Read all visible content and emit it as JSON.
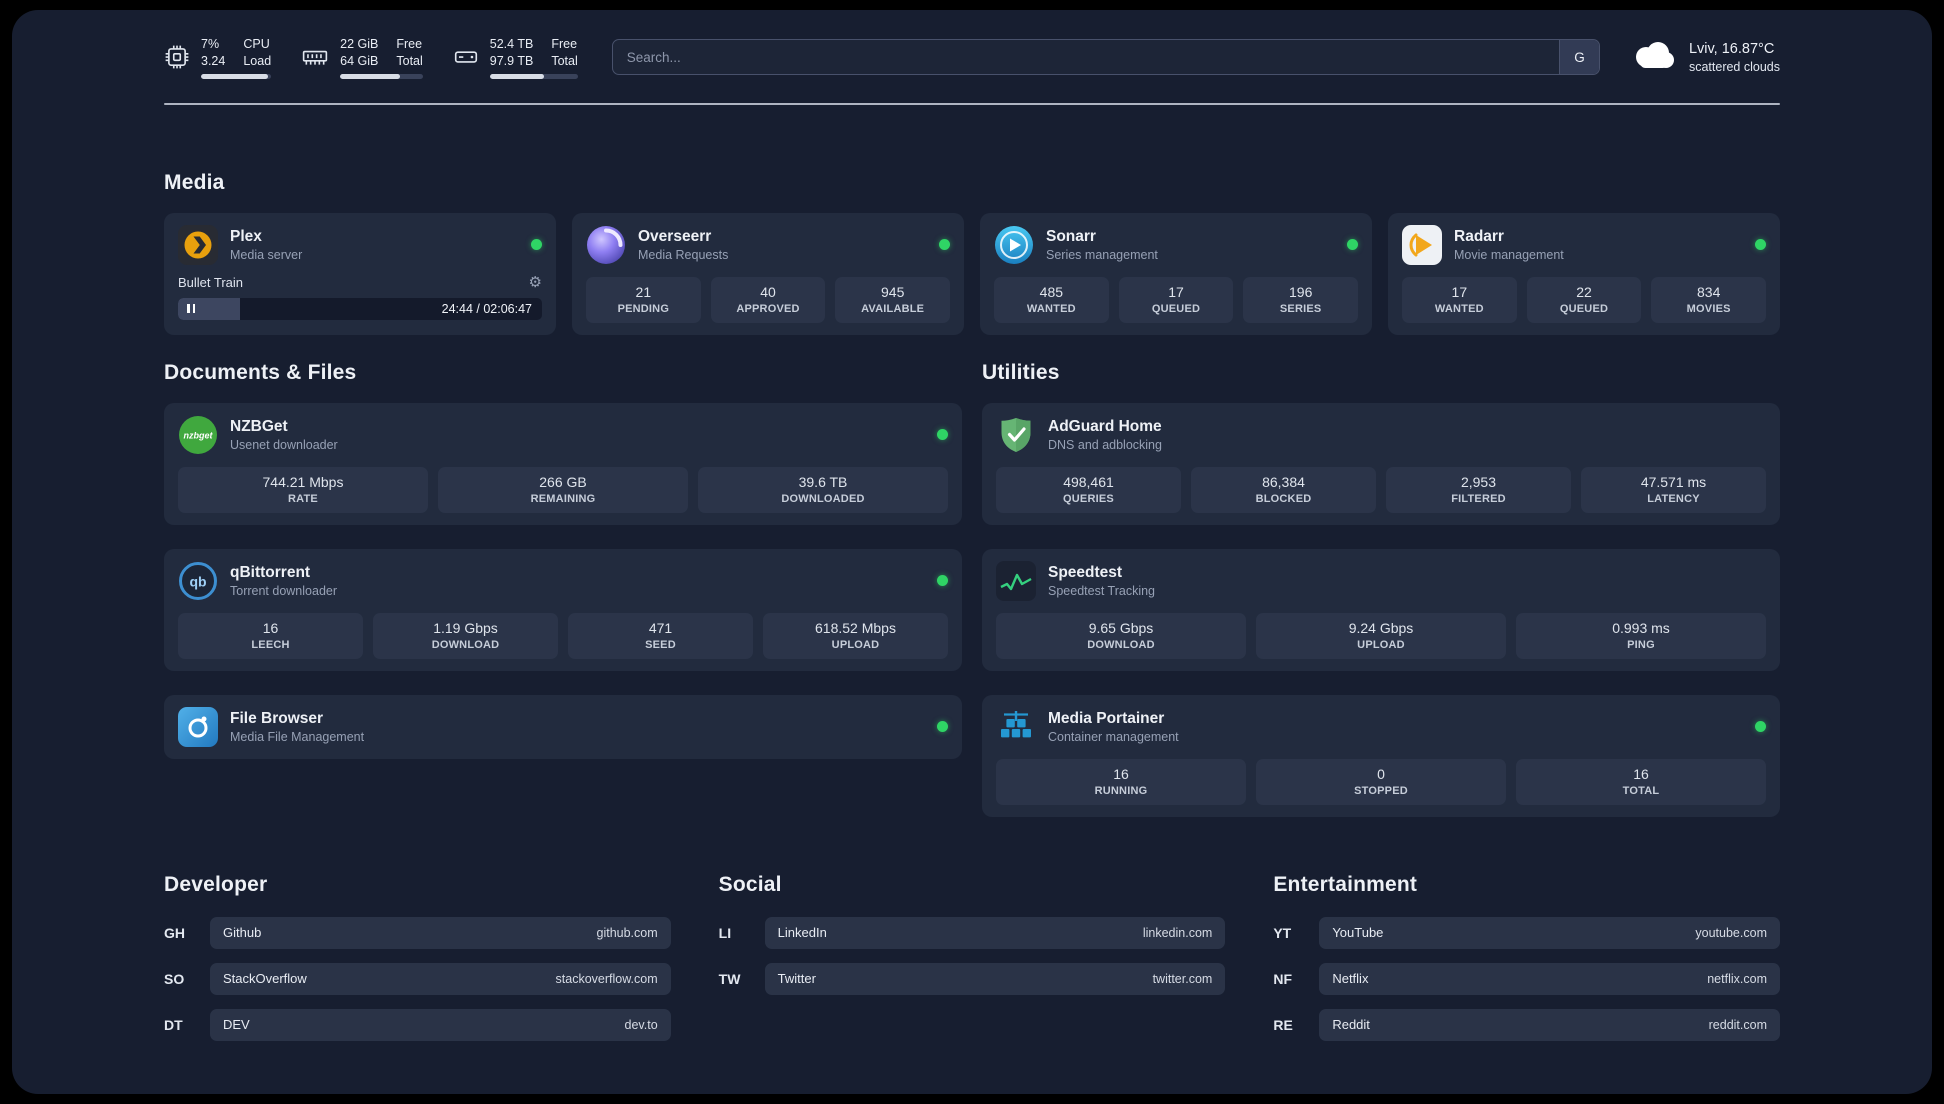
{
  "colors": {
    "status_online": "#2fd465",
    "accent_bar": "#d8dde6"
  },
  "topbar": {
    "cpu": {
      "percent": "7%",
      "load": "3.24",
      "label_top": "CPU",
      "label_bottom": "Load",
      "bar_percent": 95
    },
    "memory": {
      "free": "22 GiB",
      "total": "64 GiB",
      "label_top": "Free",
      "label_bottom": "Total",
      "bar_percent": 72
    },
    "storage": {
      "free": "52.4 TB",
      "total": "97.9 TB",
      "label_top": "Free",
      "label_bottom": "Total",
      "bar_percent": 62
    },
    "search_placeholder": "Search...",
    "search_button": "G",
    "weather_location": "Lviv, 16.87°C",
    "weather_condition": "scattered clouds"
  },
  "media": {
    "title": "Media",
    "plex": {
      "name": "Plex",
      "subtitle": "Media server",
      "track": "Bullet Train",
      "time": "24:44 / 02:06:47",
      "progress_percent": 17
    },
    "overseerr": {
      "name": "Overseerr",
      "subtitle": "Media Requests",
      "stats": [
        {
          "value": "21",
          "label": "PENDING"
        },
        {
          "value": "40",
          "label": "APPROVED"
        },
        {
          "value": "945",
          "label": "AVAILABLE"
        }
      ]
    },
    "sonarr": {
      "name": "Sonarr",
      "subtitle": "Series management",
      "stats": [
        {
          "value": "485",
          "label": "WANTED"
        },
        {
          "value": "17",
          "label": "QUEUED"
        },
        {
          "value": "196",
          "label": "SERIES"
        }
      ]
    },
    "radarr": {
      "name": "Radarr",
      "subtitle": "Movie management",
      "stats": [
        {
          "value": "17",
          "label": "WANTED"
        },
        {
          "value": "22",
          "label": "QUEUED"
        },
        {
          "value": "834",
          "label": "MOVIES"
        }
      ]
    }
  },
  "documents": {
    "title": "Documents & Files",
    "nzbget": {
      "name": "NZBGet",
      "subtitle": "Usenet downloader",
      "icon_text": "nzbget",
      "stats": [
        {
          "value": "744.21 Mbps",
          "label": "RATE"
        },
        {
          "value": "266 GB",
          "label": "REMAINING"
        },
        {
          "value": "39.6 TB",
          "label": "DOWNLOADED"
        }
      ]
    },
    "qbittorrent": {
      "name": "qBittorrent",
      "subtitle": "Torrent downloader",
      "icon_text": "qb",
      "stats": [
        {
          "value": "16",
          "label": "LEECH"
        },
        {
          "value": "1.19 Gbps",
          "label": "DOWNLOAD"
        },
        {
          "value": "471",
          "label": "SEED"
        },
        {
          "value": "618.52 Mbps",
          "label": "UPLOAD"
        }
      ]
    },
    "filebrowser": {
      "name": "File Browser",
      "subtitle": "Media File Management"
    }
  },
  "utilities": {
    "title": "Utilities",
    "adguard": {
      "name": "AdGuard Home",
      "subtitle": "DNS and adblocking",
      "stats": [
        {
          "value": "498,461",
          "label": "QUERIES"
        },
        {
          "value": "86,384",
          "label": "BLOCKED"
        },
        {
          "value": "2,953",
          "label": "FILTERED"
        },
        {
          "value": "47.571 ms",
          "label": "LATENCY"
        }
      ]
    },
    "speedtest": {
      "name": "Speedtest",
      "subtitle": "Speedtest Tracking",
      "stats": [
        {
          "value": "9.65 Gbps",
          "label": "DOWNLOAD"
        },
        {
          "value": "9.24 Gbps",
          "label": "UPLOAD"
        },
        {
          "value": "0.993 ms",
          "label": "PING"
        }
      ]
    },
    "portainer": {
      "name": "Media Portainer",
      "subtitle": "Container management",
      "stats": [
        {
          "value": "16",
          "label": "RUNNING"
        },
        {
          "value": "0",
          "label": "STOPPED"
        },
        {
          "value": "16",
          "label": "TOTAL"
        }
      ]
    }
  },
  "bookmarks": [
    {
      "title": "Developer",
      "items": [
        {
          "abbr": "GH",
          "name": "Github",
          "url": "github.com"
        },
        {
          "abbr": "SO",
          "name": "StackOverflow",
          "url": "stackoverflow.com"
        },
        {
          "abbr": "DT",
          "name": "DEV",
          "url": "dev.to"
        }
      ]
    },
    {
      "title": "Social",
      "items": [
        {
          "abbr": "LI",
          "name": "LinkedIn",
          "url": "linkedin.com"
        },
        {
          "abbr": "TW",
          "name": "Twitter",
          "url": "twitter.com"
        }
      ]
    },
    {
      "title": "Entertainment",
      "items": [
        {
          "abbr": "YT",
          "name": "YouTube",
          "url": "youtube.com"
        },
        {
          "abbr": "NF",
          "name": "Netflix",
          "url": "netflix.com"
        },
        {
          "abbr": "RE",
          "name": "Reddit",
          "url": "reddit.com"
        }
      ]
    }
  ]
}
